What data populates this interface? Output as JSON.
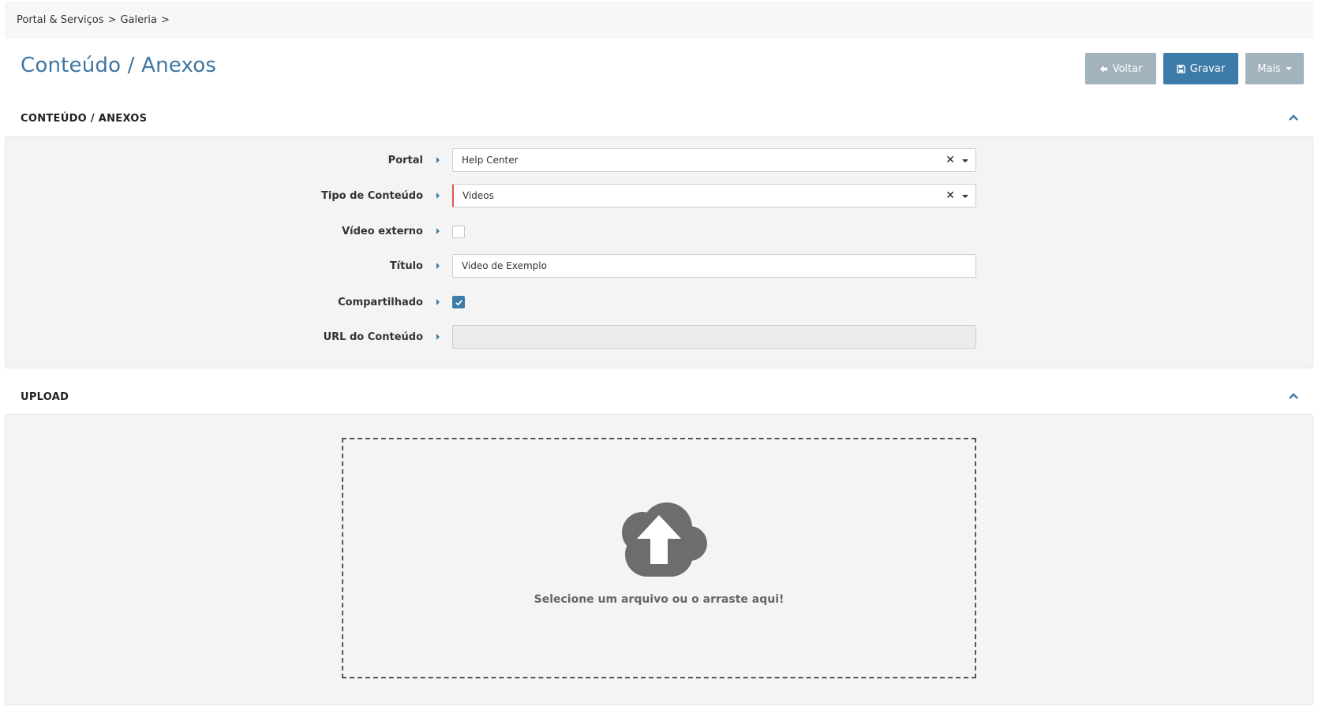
{
  "breadcrumb": {
    "items": [
      "Portal & Serviços",
      "Galeria"
    ],
    "separator": ">"
  },
  "page": {
    "title": "Conteúdo / Anexos"
  },
  "toolbar": {
    "back_label": "Voltar",
    "save_label": "Gravar",
    "more_label": "Mais"
  },
  "sections": {
    "content": {
      "header": "CONTEÚDO / ANEXOS",
      "fields": {
        "portal": {
          "label": "Portal",
          "value": "Help Center"
        },
        "content_type": {
          "label": "Tipo de Conteúdo",
          "value": "Videos"
        },
        "external_video": {
          "label": "Vídeo externo",
          "checked": false
        },
        "title": {
          "label": "Título",
          "value": "Video de Exemplo"
        },
        "shared": {
          "label": "Compartilhado",
          "checked": true
        },
        "content_url": {
          "label": "URL do Conteúdo",
          "value": ""
        }
      }
    },
    "upload": {
      "header": "UPLOAD",
      "dropzone_text": "Selecione um arquivo ou o arraste aqui!"
    }
  },
  "colors": {
    "accent": "#3d7ba8",
    "title": "#3f76a3",
    "muted_button": "#a3b3be",
    "required": "#d9534f",
    "panel_bg": "#f4f4f4"
  },
  "icons": {
    "back": "arrow-left-icon",
    "save": "floppy-disk-icon",
    "more": "caret-down-icon",
    "collapse": "chevron-up-icon",
    "clear": "times-icon",
    "upload": "cloud-upload-icon",
    "checked": "checkmark-icon"
  }
}
